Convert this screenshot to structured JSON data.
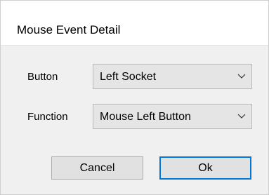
{
  "dialog": {
    "title": "Mouse Event Detail"
  },
  "fields": {
    "button": {
      "label": "Button",
      "value": "Left Socket"
    },
    "function": {
      "label": "Function",
      "value": "Mouse Left Button"
    }
  },
  "buttons": {
    "cancel": "Cancel",
    "ok": "Ok"
  },
  "icons": {
    "dropdown": "chevron-down-icon"
  },
  "colors": {
    "focus_border": "#0078d7",
    "titlebar_bg": "#ffffff",
    "body_bg": "#f0f0f0"
  }
}
